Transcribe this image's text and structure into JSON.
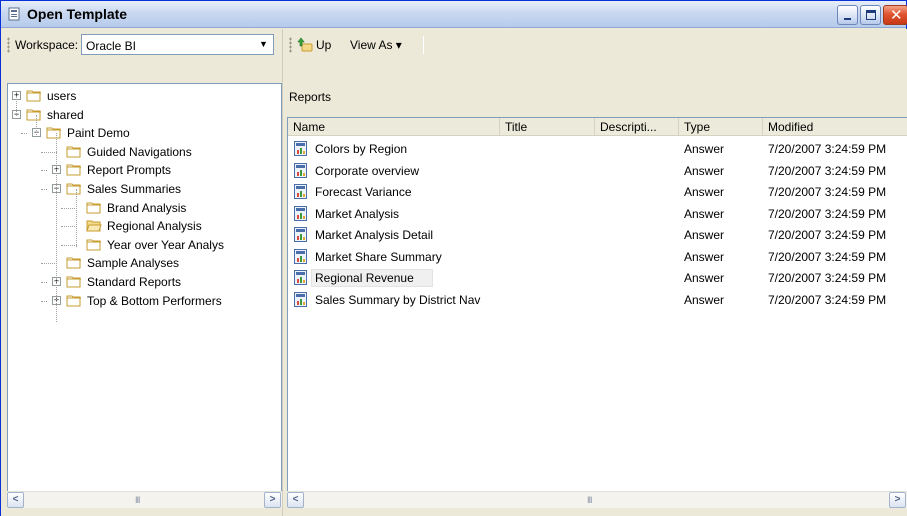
{
  "window": {
    "title": "Open Template"
  },
  "workspace": {
    "label": "Workspace:",
    "value": "Oracle BI"
  },
  "tree": [
    {
      "label": "users",
      "level": 0,
      "expander": "+"
    },
    {
      "label": "shared",
      "level": 0,
      "expander": "−"
    },
    {
      "label": "Paint Demo",
      "level": 1,
      "expander": "−"
    },
    {
      "label": "Guided Navigations",
      "level": 2,
      "expander": ""
    },
    {
      "label": "Report Prompts",
      "level": 2,
      "expander": "+"
    },
    {
      "label": "Sales Summaries",
      "level": 2,
      "expander": "−"
    },
    {
      "label": "Brand Analysis",
      "level": 3,
      "expander": ""
    },
    {
      "label": "Regional Analysis",
      "level": 3,
      "expander": "",
      "open": true
    },
    {
      "label": "Year over Year Analys",
      "level": 3,
      "expander": ""
    },
    {
      "label": "Sample Analyses",
      "level": 2,
      "expander": ""
    },
    {
      "label": "Standard Reports",
      "level": 2,
      "expander": "+"
    },
    {
      "label": "Top & Bottom Performers",
      "level": 2,
      "expander": "+"
    }
  ],
  "toolbar": {
    "up_label": "Up",
    "view_as_label": "View As ▾"
  },
  "breadcrumb": "Reports",
  "columns": [
    "Name",
    "Title",
    "Descripti...",
    "Type",
    "Modified"
  ],
  "rows": [
    {
      "name": "Colors by Region",
      "title": "",
      "description": "",
      "type": "Answer",
      "modified": "7/20/2007 3:24:59 PM"
    },
    {
      "name": "Corporate overview",
      "title": "",
      "description": "",
      "type": "Answer",
      "modified": "7/20/2007 3:24:59 PM"
    },
    {
      "name": "Forecast Variance",
      "title": "",
      "description": "",
      "type": "Answer",
      "modified": "7/20/2007 3:24:59 PM"
    },
    {
      "name": "Market Analysis",
      "title": "",
      "description": "",
      "type": "Answer",
      "modified": "7/20/2007 3:24:59 PM"
    },
    {
      "name": "Market Analysis Detail",
      "title": "",
      "description": "",
      "type": "Answer",
      "modified": "7/20/2007 3:24:59 PM"
    },
    {
      "name": "Market Share Summary",
      "title": "",
      "description": "",
      "type": "Answer",
      "modified": "7/20/2007 3:24:59 PM"
    },
    {
      "name": "Regional Revenue",
      "title": "",
      "description": "",
      "type": "Answer",
      "modified": "7/20/2007 3:24:59 PM",
      "selected": true
    },
    {
      "name": "Sales Summary by District Nav",
      "title": "",
      "description": "",
      "type": "Answer",
      "modified": "7/20/2007 3:24:59 PM"
    }
  ],
  "scroll": {
    "left_arrow": "<",
    "right_arrow": ">",
    "thumb_grip": "III"
  },
  "colors": {
    "folder": "#f5d98b",
    "folder_stroke": "#c69c2e",
    "title_bar": "#c9d8f0",
    "close_button": "#e0552f"
  }
}
